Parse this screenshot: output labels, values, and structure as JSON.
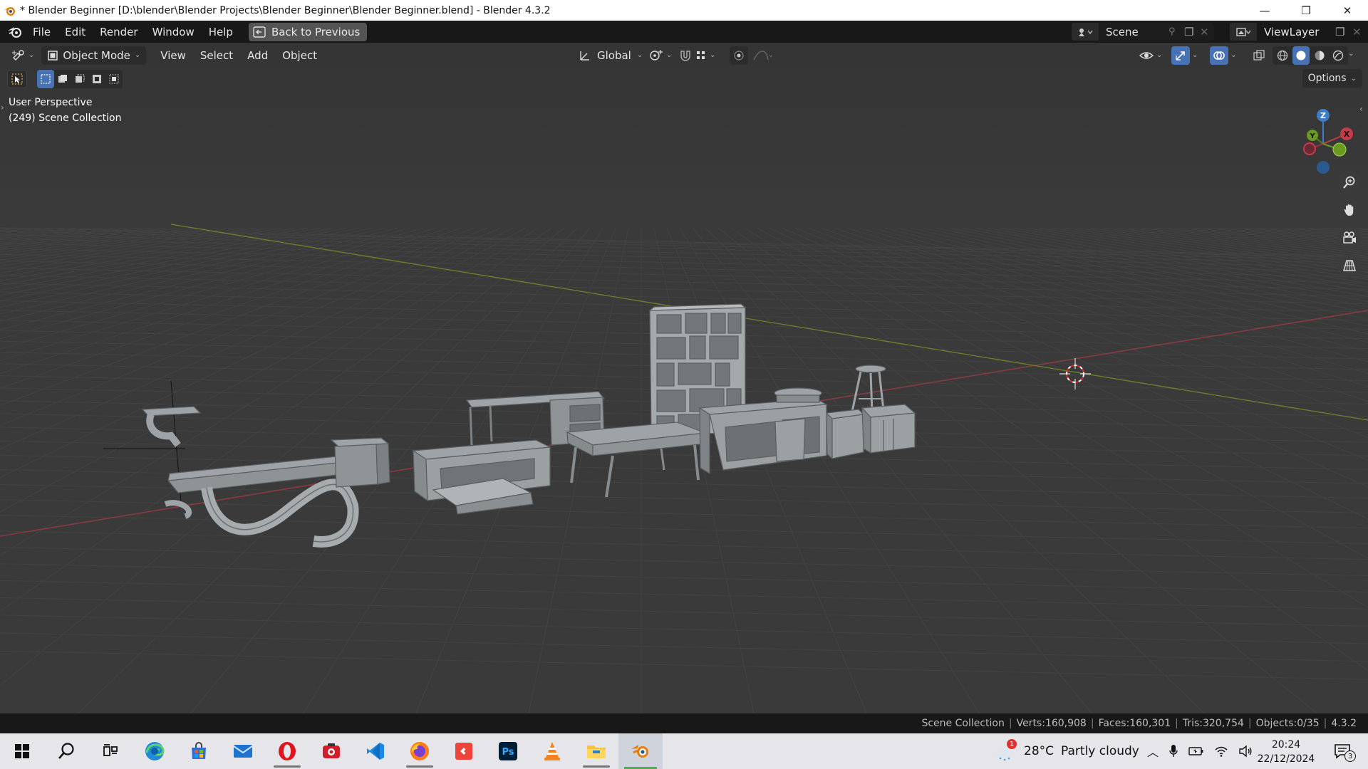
{
  "window": {
    "title": "* Blender Beginner [D:\\blender\\Blender Projects\\Blender Beginner\\Blender Beginner.blend] - Blender 4.3.2",
    "minimize_glyph": "—",
    "maximize_glyph": "❐",
    "close_glyph": "✕"
  },
  "menu": {
    "items": [
      "File",
      "Edit",
      "Render",
      "Window",
      "Help"
    ],
    "back_button": "Back to Previous"
  },
  "scene": {
    "name": "Scene",
    "view_layer": "ViewLayer"
  },
  "viewport_header": {
    "mode": "Object Mode",
    "menus": [
      "View",
      "Select",
      "Add",
      "Object"
    ],
    "transform_orientation": "Global",
    "options_label": "Options"
  },
  "viewport": {
    "perspective_label": "User Perspective",
    "collection_label": "(249) Scene Collection",
    "gizmo": {
      "z": "Z",
      "y": "Y",
      "x": "X"
    },
    "axis_colors": {
      "x": "#c43c4a",
      "y": "#6a9a1f",
      "z": "#3d7cc9"
    }
  },
  "status_bar": {
    "collection": "Scene Collection",
    "verts": "Verts:160,908",
    "faces": "Faces:160,301",
    "tris": "Tris:320,754",
    "objects": "Objects:0/35",
    "version": "4.3.2"
  },
  "taskbar": {
    "apps": [
      "start",
      "search",
      "task-view",
      "edge",
      "store",
      "mail",
      "opera",
      "camera",
      "vscode",
      "firefox",
      "anydesk",
      "photoshop",
      "vlc",
      "file-explorer",
      "blender"
    ],
    "weather_temp": "28°C",
    "weather_desc": "Partly cloudy",
    "weather_badge": "1",
    "time": "20:24",
    "date": "22/12/2024",
    "notification_count": "3"
  }
}
